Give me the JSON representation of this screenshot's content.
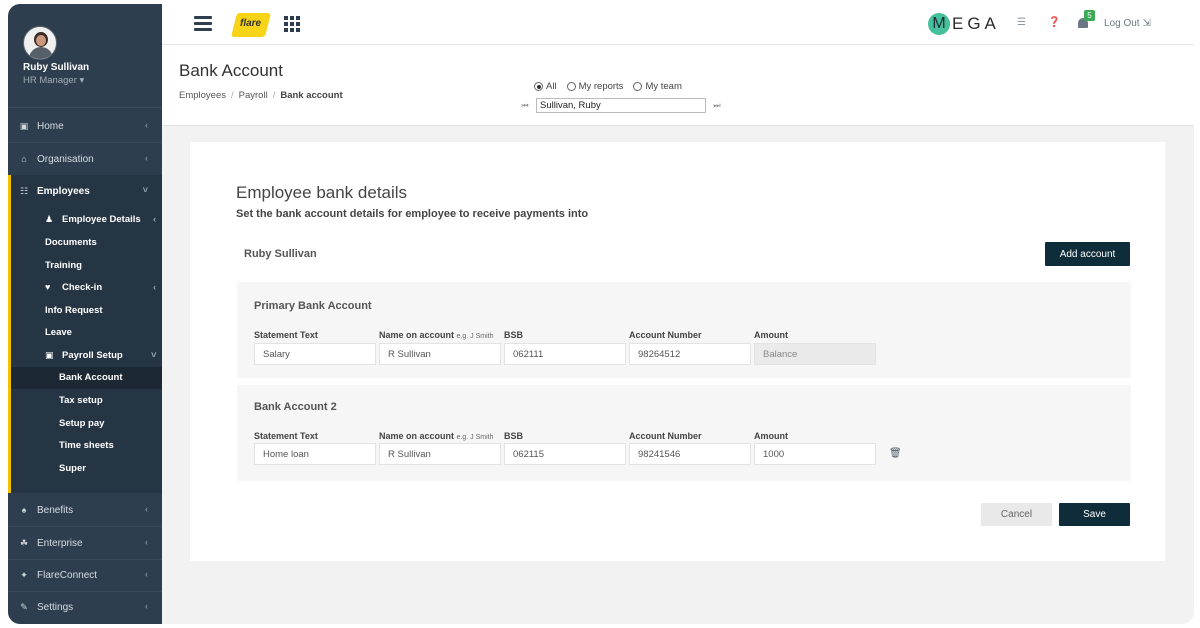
{
  "user": {
    "name": "Ruby Sullivan",
    "role": "HR Manager ▾"
  },
  "sidebar": {
    "items": [
      {
        "icon": "▣",
        "label": "Home",
        "chevron": "‹"
      },
      {
        "icon": "⌂",
        "label": "Organisation",
        "chevron": "‹"
      },
      {
        "icon": "☷",
        "label": "Employees",
        "chevron": "˅"
      },
      {
        "icon": "♠",
        "label": "Benefits",
        "chevron": "‹"
      },
      {
        "icon": "☘",
        "label": "Enterprise",
        "chevron": "‹"
      },
      {
        "icon": "✦",
        "label": "FlareConnect",
        "chevron": "‹"
      },
      {
        "icon": "✎",
        "label": "Settings",
        "chevron": "‹"
      }
    ],
    "employee_sub": {
      "employee_details": "Employee Details",
      "documents": "Documents",
      "training": "Training",
      "checkin": "Check-in",
      "info_request": "Info Request",
      "leave": "Leave",
      "payroll_setup": "Payroll Setup",
      "bank_account": "Bank Account",
      "tax_setup": "Tax setup",
      "setup_pay": "Setup pay",
      "time_sheets": "Time sheets",
      "super": "Super"
    }
  },
  "topbar": {
    "logo_text": "flare",
    "brand_m": "M",
    "brand_rest": "EGA",
    "notification_count": "5",
    "logout_label": "Log Out ⇲"
  },
  "header": {
    "title": "Bank Account",
    "breadcrumb": [
      "Employees",
      "Payroll",
      "Bank account"
    ],
    "filter_options": [
      "All",
      "My reports",
      "My team"
    ],
    "selected_filter": "All",
    "employee_value": "Sullivan, Ruby"
  },
  "card": {
    "title": "Employee bank details",
    "subtitle": "Set the bank account details for employee to receive payments into",
    "employee_name": "Ruby Sullivan",
    "add_account_label": "Add account",
    "cancel_label": "Cancel",
    "save_label": "Save"
  },
  "columns": {
    "statement_text": "Statement Text",
    "name_on_account": "Name on account",
    "name_hint": "e.g. J Smith",
    "bsb": "BSB",
    "account_number": "Account Number",
    "amount": "Amount"
  },
  "accounts": [
    {
      "title": "Primary Bank Account",
      "statement_text": "Salary",
      "name_on_account": "R Sullivan",
      "bsb": "062111",
      "account_number": "98264512",
      "amount": "Balance"
    },
    {
      "title": "Bank Account 2",
      "statement_text": "Home loan",
      "name_on_account": "R Sullivan",
      "bsb": "062115",
      "account_number": "98241546",
      "amount": "1000"
    }
  ],
  "colors": {
    "sidebar": "#2e3e4e",
    "accent": "#f2c200",
    "primary_button": "#0f2c3a",
    "brand_green": "#45c09a"
  }
}
